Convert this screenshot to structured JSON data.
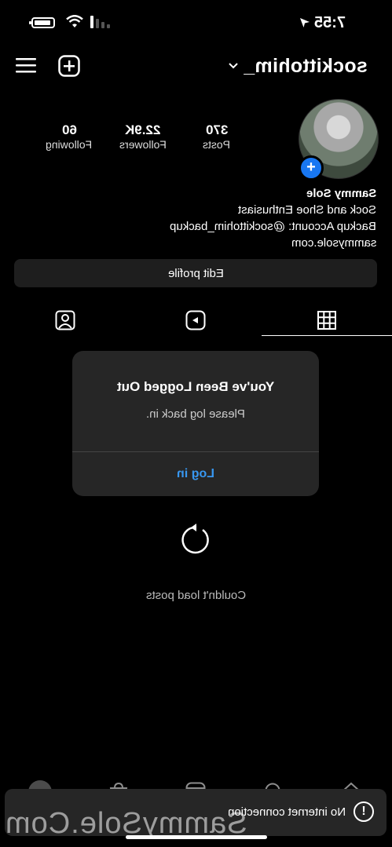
{
  "status_bar": {
    "time": "7:55"
  },
  "header": {
    "username": "sockittohim_"
  },
  "profile": {
    "stats": [
      {
        "value": "370",
        "label": "Posts"
      },
      {
        "value": "22.9K",
        "label": "Followers"
      },
      {
        "value": "60",
        "label": "Following"
      }
    ],
    "bio": {
      "name": "Sammy Sole",
      "lines": [
        "Sock and Shoe Enthusiast",
        "Backup Account: @sockittohim_backup"
      ],
      "link": "sammysole.com"
    },
    "edit_button": "Edit profile"
  },
  "tabs": {
    "icons": [
      "grid-icon",
      "reels-icon",
      "tagged-icon"
    ],
    "active": "grid"
  },
  "dialog": {
    "title": "You've Been Logged Out",
    "message": "Please log back in.",
    "button": "Log in"
  },
  "feed": {
    "error": "Couldn't load posts"
  },
  "toast": {
    "text": "No internet connection"
  },
  "watermark": "SammySole.Com",
  "colors": {
    "accent": "#1877f2",
    "link": "#3897f0",
    "dialog_bg": "#262626"
  }
}
